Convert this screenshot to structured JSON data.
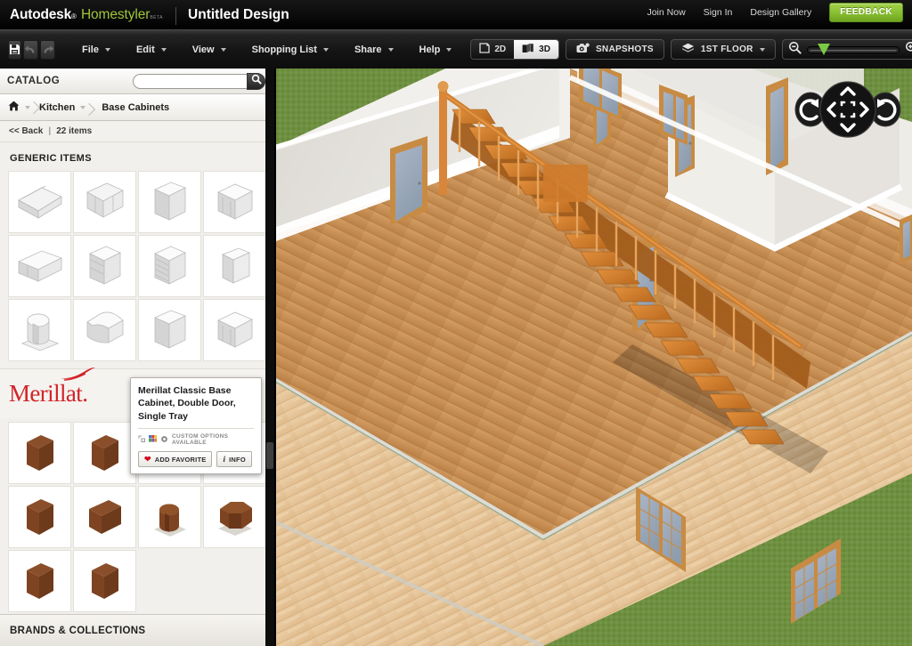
{
  "brandbar": {
    "logo_autodesk": "Autodesk",
    "logo_reg": "®",
    "logo_product": "Homestyler",
    "logo_beta": "BETA",
    "document_title": "Untitled Design",
    "links": [
      {
        "label": "Join Now",
        "name": "join-now-link"
      },
      {
        "label": "Sign In",
        "name": "sign-in-link"
      },
      {
        "label": "Design Gallery",
        "name": "design-gallery-link"
      }
    ],
    "feedback_label": "FEEDBACK",
    "feedback_color": "#8cc334"
  },
  "toolbar": {
    "icons": [
      {
        "name": "save-icon",
        "title": "Save"
      },
      {
        "name": "undo-icon",
        "title": "Undo"
      },
      {
        "name": "redo-icon",
        "title": "Redo"
      }
    ],
    "menus": [
      {
        "label": "File"
      },
      {
        "label": "Edit"
      },
      {
        "label": "View"
      },
      {
        "label": "Shopping List"
      },
      {
        "label": "Share"
      },
      {
        "label": "Help"
      }
    ],
    "view_modes": [
      {
        "label": "2D",
        "active": false
      },
      {
        "label": "3D",
        "active": true
      }
    ],
    "snapshots_label": "SNAPSHOTS",
    "floor_label": "1ST FLOOR",
    "zoom_value_percent": 18,
    "zoom_out_icon": "zoom-out-icon",
    "zoom_in_icon": "zoom-in-icon",
    "fullscreen_icon": "fullscreen-icon"
  },
  "catalog": {
    "title": "CATALOG",
    "search_placeholder": "",
    "search_value": "",
    "breadcrumb": [
      {
        "label": "",
        "icon": "home-icon",
        "name": "breadcrumb-home"
      },
      {
        "label": "Kitchen",
        "name": "breadcrumb-kitchen"
      },
      {
        "label": "Base Cabinets",
        "name": "breadcrumb-base-cabinets"
      }
    ],
    "back_label": "<< Back",
    "divider": "|",
    "item_count_label": "22 items",
    "section_generic_label": "GENERIC ITEMS",
    "brand_name": "Merillat",
    "brand_period": ".",
    "footer_label": "BRANDS & COLLECTIONS",
    "generic_items": [
      {
        "shape": "long-cabinet-open",
        "name": "catalog-item-1"
      },
      {
        "shape": "double-base-glass",
        "name": "catalog-item-2"
      },
      {
        "shape": "tall-block",
        "name": "catalog-item-3"
      },
      {
        "shape": "sink-base",
        "name": "catalog-item-4"
      },
      {
        "shape": "long-base",
        "name": "catalog-item-5"
      },
      {
        "shape": "drawer-stack-3",
        "name": "catalog-item-6"
      },
      {
        "shape": "drawer-stack-4",
        "name": "catalog-item-7"
      },
      {
        "shape": "plain-panel",
        "name": "catalog-item-8"
      },
      {
        "shape": "lazy-susan-round",
        "name": "catalog-item-9"
      },
      {
        "shape": "corner-curved",
        "name": "catalog-item-10"
      },
      {
        "shape": "tall-block2",
        "name": "catalog-item-11"
      },
      {
        "shape": "sink-base2",
        "name": "catalog-item-12"
      }
    ],
    "brand_items": [
      {
        "shape": "wood-box",
        "name": "brand-item-1"
      },
      {
        "shape": "wood-box",
        "name": "brand-item-2"
      },
      {
        "shape": "wood-angle",
        "name": "brand-item-3"
      },
      {
        "shape": "wood-angle",
        "name": "brand-item-4"
      },
      {
        "shape": "wood-box",
        "name": "brand-item-5"
      },
      {
        "shape": "wood-box",
        "name": "brand-item-6"
      },
      {
        "shape": "wood-round",
        "name": "brand-item-7"
      },
      {
        "shape": "wood-octagon",
        "name": "brand-item-8"
      },
      {
        "shape": "wood-box",
        "name": "brand-item-9"
      },
      {
        "shape": "wood-box",
        "name": "brand-item-10"
      }
    ]
  },
  "tooltip": {
    "title": "Merillat Classic Base Cabinet, Double Door, Single Tray",
    "custom_options_label": "CUSTOM OPTIONS AVAILABLE",
    "add_favorite_label": "ADD FAVORITE",
    "info_label": "INFO"
  },
  "viewport": {
    "nav_buttons": [
      {
        "name": "nav-rotate-left-icon"
      },
      {
        "name": "nav-pan-up-icon"
      },
      {
        "name": "nav-pan-left-icon"
      },
      {
        "name": "nav-center-icon"
      },
      {
        "name": "nav-pan-right-icon"
      },
      {
        "name": "nav-pan-down-icon"
      },
      {
        "name": "nav-rotate-right-icon"
      }
    ],
    "colors": {
      "grass": "#6f9140",
      "floor_wood": "#c18e54",
      "wall_interior": "#e9e7e2",
      "exterior_siding": "#e8c79a",
      "stair_wood": "#cf7b2b",
      "door_frame": "#c88b43",
      "door_panel": "#9aa7b8"
    },
    "scene_description": "3D isometric floor plan of a first floor with hardwood floors, white interior walls, multiple doors, windows and a wooden staircase"
  }
}
